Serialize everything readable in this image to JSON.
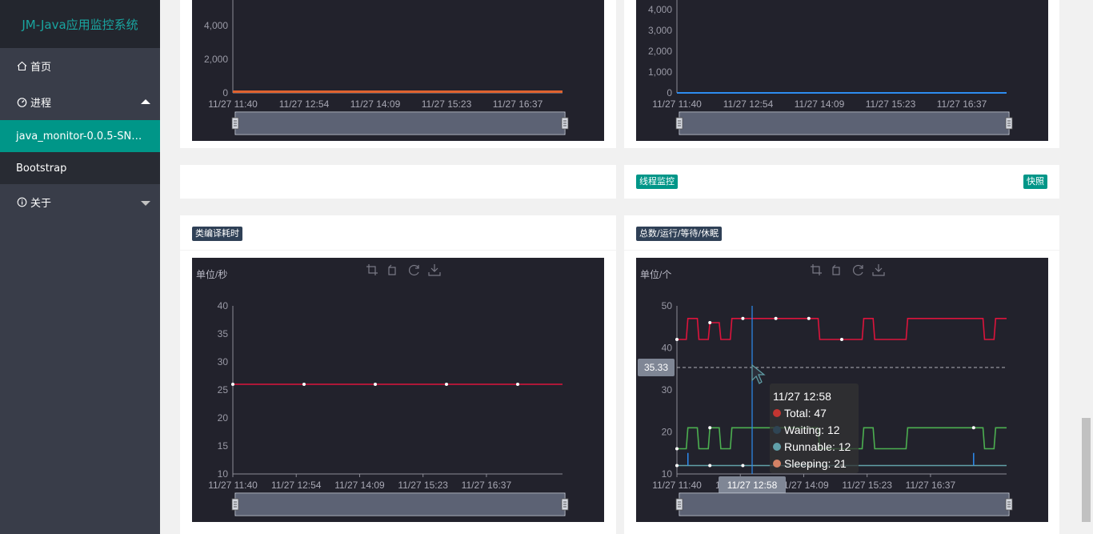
{
  "sidebar": {
    "brand": "JM-Java应用监控系统",
    "home": "首页",
    "process": "进程",
    "app": "java_monitor-0.0.5-SN…",
    "bootstrap": "Bootstrap",
    "about": "关于"
  },
  "cards": {
    "thread_monitor_label": "线程监控",
    "snapshot_label": "快照",
    "class_compile_label": "类编译耗时",
    "threads_label": "总数/运行/等待/休眠"
  },
  "toolbox_icons": [
    "crop-icon",
    "undo-icon",
    "refresh-icon",
    "download-icon"
  ],
  "chart_data": [
    {
      "id": "top-left",
      "type": "area",
      "x_ticks": [
        "11/27 11:40",
        "11/27 12:54",
        "11/27 14:09",
        "11/27 15:23",
        "11/27 16:37"
      ],
      "y_ticks": [
        "0",
        "2,000",
        "4,000"
      ],
      "series": [
        {
          "values": [
            50,
            50,
            50,
            50,
            50,
            50
          ],
          "color": "#e0622f"
        }
      ],
      "ylim": [
        0,
        4000
      ]
    },
    {
      "id": "top-right",
      "type": "line",
      "x_ticks": [
        "11/27 11:40",
        "11/27 12:54",
        "11/27 14:09",
        "11/27 15:23",
        "11/27 16:37"
      ],
      "y_ticks": [
        "0",
        "1,000",
        "2,000",
        "3,000",
        "4,000"
      ],
      "series": [
        {
          "values": [
            0,
            0,
            0,
            0,
            0,
            0
          ],
          "color": "#2d8cf0"
        }
      ],
      "ylim": [
        0,
        4000
      ]
    },
    {
      "id": "class-compile",
      "type": "line",
      "unit": "单位/秒",
      "x_ticks": [
        "11/27 11:40",
        "11/27 12:54",
        "11/27 14:09",
        "11/27 15:23",
        "11/27 16:37"
      ],
      "y_ticks": [
        "10",
        "15",
        "20",
        "25",
        "30",
        "35",
        "40"
      ],
      "ylim": [
        10,
        40
      ],
      "series": [
        {
          "values": [
            26,
            26,
            26,
            26,
            26,
            26
          ],
          "color": "#dc143c"
        }
      ]
    },
    {
      "id": "threads",
      "type": "line",
      "unit": "单位/个",
      "x_ticks": [
        "11/27 11:40",
        "11/27 12:54",
        "11/27 14:09",
        "11/27 15:23",
        "11/27 16:37"
      ],
      "y_ticks": [
        "10",
        "20",
        "30",
        "40",
        "50"
      ],
      "ylim": [
        10,
        50
      ],
      "pointer_value": "35.33",
      "pointer_x": "11/27 12:58",
      "series": [
        {
          "name": "Total",
          "color": "#dc143c",
          "values": [
            42,
            47,
            42,
            46,
            42,
            47,
            47,
            47,
            47,
            47,
            47,
            47,
            47,
            42,
            42,
            42,
            42,
            47,
            42,
            42,
            42,
            47,
            47,
            47,
            47,
            47,
            47,
            47,
            42,
            47,
            47
          ]
        },
        {
          "name": "Waiting",
          "color": "#2f4554",
          "values": [
            12,
            12,
            12,
            12,
            12,
            12,
            12,
            12,
            12,
            12,
            12,
            12,
            12,
            12,
            12,
            12,
            12,
            12,
            12,
            12,
            12,
            12,
            12,
            12,
            12,
            12,
            12,
            12,
            12,
            12,
            12
          ]
        },
        {
          "name": "Runnable",
          "color": "#61a0a8",
          "values": [
            12,
            12,
            12,
            12,
            12,
            12,
            12,
            12,
            12,
            12,
            12,
            12,
            12,
            12,
            12,
            12,
            12,
            12,
            12,
            12,
            12,
            12,
            12,
            12,
            12,
            12,
            12,
            12,
            12,
            12,
            12
          ]
        },
        {
          "name": "Sleeping",
          "color": "#4caf50",
          "values": [
            16,
            21,
            16,
            21,
            16,
            21,
            21,
            21,
            21,
            21,
            21,
            21,
            21,
            16,
            16,
            16,
            16,
            21,
            16,
            16,
            16,
            21,
            21,
            21,
            21,
            21,
            21,
            21,
            16,
            21,
            21
          ]
        }
      ],
      "tooltip": {
        "title": "11/27 12:58",
        "items": [
          {
            "label": "Total: 47",
            "color": "#c23531"
          },
          {
            "label": "Waiting: 12",
            "color": "#2f4554"
          },
          {
            "label": "Runnable: 12",
            "color": "#61a0a8"
          },
          {
            "label": "Sleeping: 21",
            "color": "#d48265"
          }
        ]
      }
    }
  ]
}
